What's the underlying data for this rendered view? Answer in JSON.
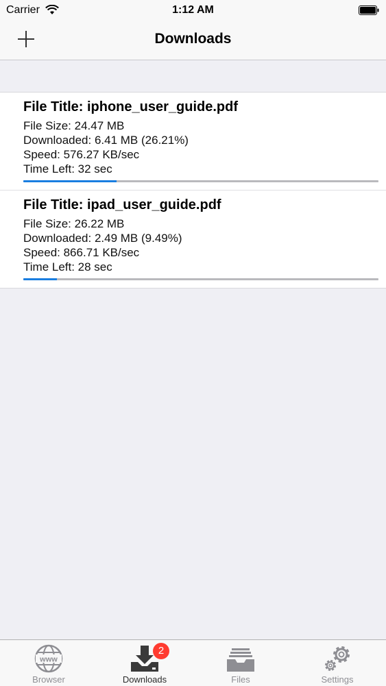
{
  "status_bar": {
    "carrier": "Carrier",
    "time": "1:12 AM"
  },
  "nav": {
    "title": "Downloads",
    "add_icon": "plus-icon"
  },
  "downloads": [
    {
      "title": "File Title: iphone_user_guide.pdf",
      "size": "File Size: 24.47 MB",
      "downloaded": "Downloaded: 6.41 MB (26.21%)",
      "speed": "Speed: 576.27 KB/sec",
      "time_left": "Time Left: 32 sec",
      "progress": 0.2621
    },
    {
      "title": "File Title: ipad_user_guide.pdf",
      "size": "File Size: 26.22 MB",
      "downloaded": "Downloaded: 2.49 MB (9.49%)",
      "speed": "Speed: 866.71 KB/sec",
      "time_left": "Time Left: 28 sec",
      "progress": 0.0949
    }
  ],
  "tabs": [
    {
      "label": "Browser",
      "icon": "globe-www-icon"
    },
    {
      "label": "Downloads",
      "icon": "download-tray-icon",
      "badge": "2"
    },
    {
      "label": "Files",
      "icon": "file-tray-icon"
    },
    {
      "label": "Settings",
      "icon": "gears-icon"
    }
  ],
  "colors": {
    "accent": "#1a7ee0",
    "badge": "#ff3b30",
    "progress_track": "#b9b9bd"
  }
}
